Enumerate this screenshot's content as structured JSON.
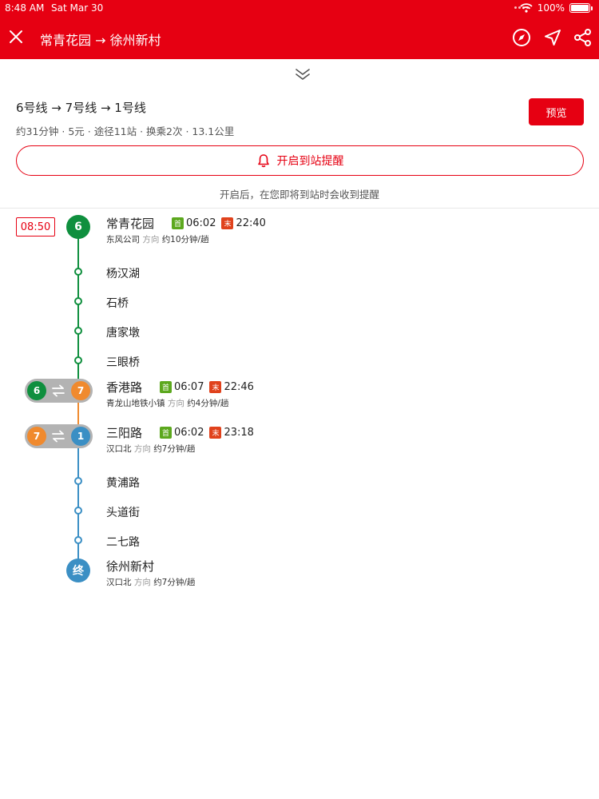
{
  "status_bar": {
    "time": "8:48 AM",
    "date": "Sat Mar 30",
    "battery": "100%"
  },
  "header": {
    "route_title": "常青花园 → 徐州新村"
  },
  "summary": {
    "lines": "6号线 → 7号线 → 1号线",
    "trip_info": "约31分钟 · 5元 · 途径11站 · 换乘2次 · 13.1公里",
    "preview_label": "预览",
    "alert_label": "开启到站提醒",
    "alert_hint": "开启后，在您即将到站时会收到提醒"
  },
  "colors": {
    "brand": "#e60012",
    "line6": "#0f8f3e",
    "line7": "#f08a2e",
    "line1": "#3b8fc4",
    "transfer_pill": "#b3b3b3"
  },
  "timeline": {
    "departure_time": "08:50",
    "start_badge": "6",
    "end_badge": "终",
    "transfer_1": {
      "from": "6",
      "to": "7"
    },
    "transfer_2": {
      "from": "7",
      "to": "1"
    },
    "first_label": "首",
    "last_label": "末",
    "direction_word": "方向",
    "stations": {
      "changqing": {
        "name": "常青花园",
        "first": "06:02",
        "last": "22:40",
        "direction": "东风公司",
        "interval": "约10分钟/趟"
      },
      "yanghanhu": {
        "name": "杨汉湖"
      },
      "shiqiao": {
        "name": "石桥"
      },
      "tangjiadun": {
        "name": "唐家墩"
      },
      "sanyanqiao": {
        "name": "三眼桥"
      },
      "xianggang": {
        "name": "香港路",
        "first": "06:07",
        "last": "22:46",
        "direction": "青龙山地铁小镇",
        "interval": "约4分钟/趟"
      },
      "sanyang": {
        "name": "三阳路",
        "first": "06:02",
        "last": "23:18",
        "direction": "汉口北",
        "interval": "约7分钟/趟"
      },
      "huangpu": {
        "name": "黄浦路"
      },
      "toudao": {
        "name": "头道街"
      },
      "erqi": {
        "name": "二七路"
      },
      "xuzhou": {
        "name": "徐州新村",
        "direction": "汉口北",
        "interval": "约7分钟/趟"
      }
    }
  }
}
